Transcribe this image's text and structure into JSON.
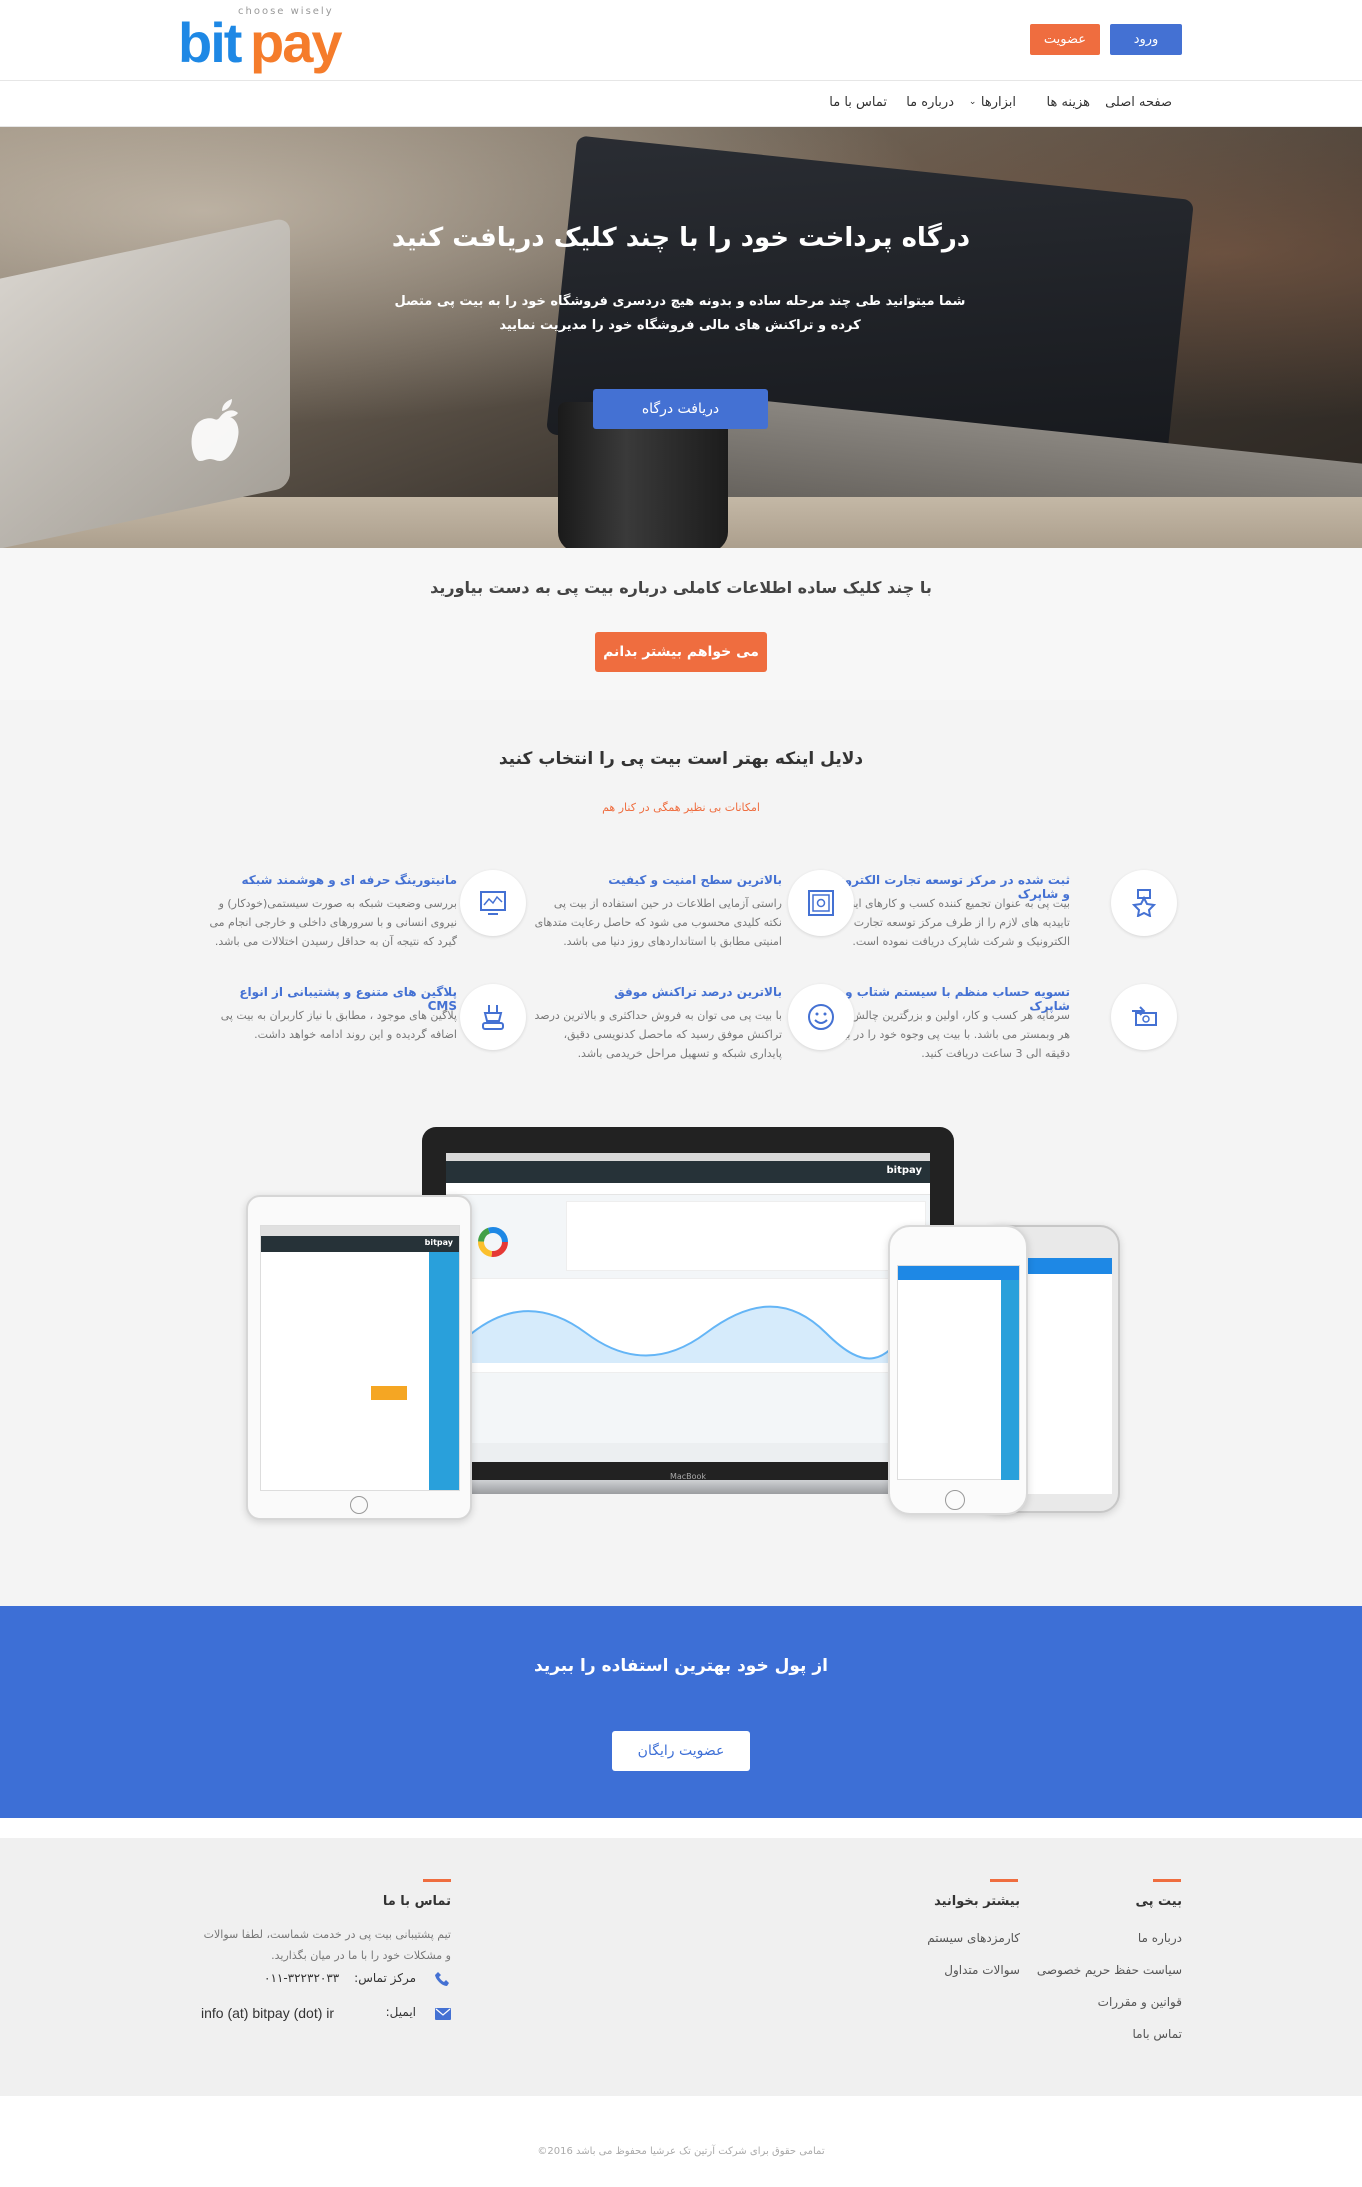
{
  "header": {
    "logo_bit": "bit",
    "logo_pay": "pay",
    "logo_tagline": "choose wisely",
    "login_label": "ورود",
    "join_label": "عضویت"
  },
  "nav": {
    "items": [
      "صفحه اصلی",
      "هزینه ها",
      "ابزارها",
      "درباره ما",
      "تماس با ما"
    ]
  },
  "hero": {
    "title": "درگاه پرداخت خود را با چند کلیک دریافت کنید",
    "subtitle": "شما میتوانید طی چند مرحله ساده و بدونه هیچ دردسری فروشگاه خود را به بیت پی متصل کرده و تراکنش های مالی فروشگاه خود را مدیریت نمایید",
    "button": "دریافت درگاه"
  },
  "info_strip": {
    "text": "با چند کلیک ساده اطلاعات کاملی درباره بیت پی به دست بیاورید",
    "button": "می خواهم بیشتر بدانم"
  },
  "features": {
    "title": "دلایل اینکه بهتر است بیت پی را انتخاب کنید",
    "subtitle": "امکانات بی نظیر همگی در کنار هم",
    "items": [
      {
        "icon": "badge-star-icon",
        "title": "ثبت شده در مرکز توسعه تجارت الکترونیک و شاپرک",
        "desc": "بیت پی به عنوان تجمیع کننده کسب و کارهای اینترنتی، تاییدیه های لازم را از طرف مرکز توسعه تجارت الکترونیک و شرکت شاپرک دریافت نموده است."
      },
      {
        "icon": "safe-icon",
        "title": "بالاترین سطح امنیت و کیفیت",
        "desc": "راستی آزمایی اطلاعات در حین استفاده از بیت پی نکته کلیدی محسوب می شود که حاصل رعایت متدهای امنیتی مطابق با استانداردهای روز دنیا می باشد."
      },
      {
        "icon": "monitor-chart-icon",
        "title": "مانیتورینگ حرفه ای و هوشمند شبکه",
        "desc": "بررسی وضعیت شبکه به صورت سیستمی(خودکار) و نیروی انسانی و با سرورهای داخلی و خارجی انجام می گیرد که نتیجه آن به حداقل رسیدن اختلالات می باشد."
      },
      {
        "icon": "money-transfer-icon",
        "title": "تسویه حساب منظم با سیستم شتاب و شاپرک",
        "desc": "سرمایه هر کسب و کار، اولین و بزرگترین چالش برای هر وبمستر می باشد. با بیت پی وجوه خود را در بین 1 دقیقه الی 3 ساعت دریافت کنید."
      },
      {
        "icon": "smile-icon",
        "title": "بالاترین درصد تراکنش موفق",
        "desc": "با بیت پی می توان به فروش حداکثری و بالاترین درصد تراکنش موفق رسید که ماحصل کدنویسی دقیق، پایداری شبکه و تسهیل مراحل خریدمی باشد."
      },
      {
        "icon": "plugin-icon",
        "title": "پلاگین های متنوع و پشتیبانی از انواع CMS",
        "desc": "پلاگین های موجود ، مطابق با نیاز کاربران به بیت پی اضافه گردیده و این روند ادامه خواهد داشت."
      }
    ]
  },
  "devices": {
    "macbook_label": "MacBook",
    "app_brand": "bitpay"
  },
  "cta": {
    "text": "از پول خود بهترین استفاده را ببرید",
    "button": "عضویت رایگان"
  },
  "footer": {
    "col1": {
      "title": "بیت پی",
      "links": [
        "درباره ما",
        "سیاست حفظ حریم خصوصی",
        "قوانین و مقررات",
        "تماس باما"
      ]
    },
    "col2": {
      "title": "بیشتر بخوانید",
      "links": [
        "کارمزدهای سیستم",
        "سوالات متداول"
      ]
    },
    "col3": {
      "title": "تماس با ما",
      "text": "تیم پشتیبانی بیت پی در خدمت شماست، لطفا سوالات و مشکلات خود را با ما در میان بگذارید.",
      "phone_label": "مرکز تماس:",
      "phone": "۰۱۱-۳۲۲۳۲۰۳۳",
      "email_label": "ایمیل:",
      "email": "info (at) bitpay (dot) ir"
    },
    "copyright": "تمامی حقوق برای شرکت آرتین تک عرشیا محفوظ می باشد 2016©"
  },
  "colors": {
    "primary": "#4471d3",
    "accent": "#ef6d3f",
    "cta_bg": "#3d6fd6"
  }
}
